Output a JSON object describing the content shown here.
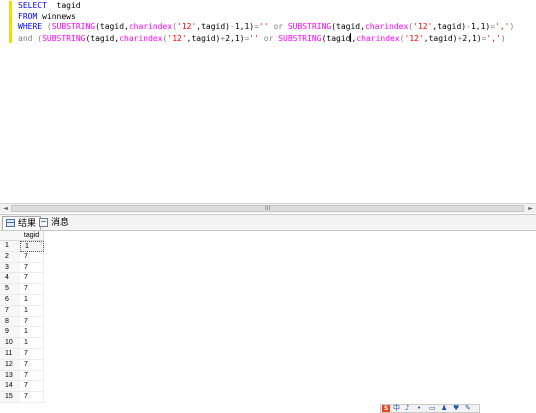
{
  "editor": {
    "lines": [
      [
        {
          "t": "SELECT",
          "c": "kw"
        },
        {
          "t": "  tagid",
          "c": ""
        }
      ],
      [
        {
          "t": "FROM",
          "c": "kw"
        },
        {
          "t": " winnews",
          "c": ""
        }
      ],
      [
        {
          "t": "WHERE",
          "c": "kw"
        },
        {
          "t": " ",
          "c": ""
        },
        {
          "t": "(",
          "c": "op"
        },
        {
          "t": "SUBSTRING",
          "c": "fn"
        },
        {
          "t": "(tagid,",
          "c": ""
        },
        {
          "t": "charindex",
          "c": "fn"
        },
        {
          "t": "(",
          "c": "op"
        },
        {
          "t": "'12'",
          "c": "str"
        },
        {
          "t": ",tagid)",
          "c": ""
        },
        {
          "t": "-",
          "c": "op"
        },
        {
          "t": "1,1)",
          "c": ""
        },
        {
          "t": "=",
          "c": "op"
        },
        {
          "t": "''",
          "c": "str"
        },
        {
          "t": " ",
          "c": ""
        },
        {
          "t": "or",
          "c": "op"
        },
        {
          "t": " ",
          "c": ""
        },
        {
          "t": "SUBSTRING",
          "c": "fn"
        },
        {
          "t": "(tagid,",
          "c": ""
        },
        {
          "t": "charindex",
          "c": "fn"
        },
        {
          "t": "(",
          "c": "op"
        },
        {
          "t": "'12'",
          "c": "str"
        },
        {
          "t": ",tagid)",
          "c": ""
        },
        {
          "t": "-",
          "c": "op"
        },
        {
          "t": "1,1)",
          "c": ""
        },
        {
          "t": "=",
          "c": "op"
        },
        {
          "t": "','",
          "c": "str"
        },
        {
          "t": ")",
          "c": "op"
        }
      ],
      [
        {
          "t": "and",
          "c": "op"
        },
        {
          "t": " ",
          "c": ""
        },
        {
          "t": "(",
          "c": "op"
        },
        {
          "t": "SUBSTRING",
          "c": "fn"
        },
        {
          "t": "(tagid,",
          "c": ""
        },
        {
          "t": "charindex",
          "c": "fn"
        },
        {
          "t": "(",
          "c": "op"
        },
        {
          "t": "'12'",
          "c": "str"
        },
        {
          "t": ",tagid)",
          "c": ""
        },
        {
          "t": "+",
          "c": "op"
        },
        {
          "t": "2,1)",
          "c": ""
        },
        {
          "t": "=",
          "c": "op"
        },
        {
          "t": "''",
          "c": "str"
        },
        {
          "t": " ",
          "c": ""
        },
        {
          "t": "or",
          "c": "op"
        },
        {
          "t": " ",
          "c": ""
        },
        {
          "t": "SUBSTRING",
          "c": "fn"
        },
        {
          "t": "(tagid",
          "c": ""
        },
        {
          "t": "|CARET|",
          "c": "caret"
        },
        {
          "t": ",",
          "c": ""
        },
        {
          "t": "charindex",
          "c": "fn"
        },
        {
          "t": "(",
          "c": "op"
        },
        {
          "t": "'12'",
          "c": "str"
        },
        {
          "t": ",tagid)",
          "c": ""
        },
        {
          "t": "+",
          "c": "op"
        },
        {
          "t": "2,1)",
          "c": ""
        },
        {
          "t": "=",
          "c": "op"
        },
        {
          "t": "','",
          "c": "str"
        },
        {
          "t": ")",
          "c": "op"
        }
      ]
    ]
  },
  "tabs": [
    {
      "label": "结果",
      "icon": "grid-icon",
      "active": true
    },
    {
      "label": "消息",
      "icon": "message-icon",
      "active": false
    }
  ],
  "results": {
    "columns": [
      "tagid"
    ],
    "rows": [
      [
        "1",
        "1"
      ],
      [
        "2",
        "7"
      ],
      [
        "3",
        "7"
      ],
      [
        "4",
        "7"
      ],
      [
        "5",
        "7"
      ],
      [
        "6",
        "1"
      ],
      [
        "7",
        "1"
      ],
      [
        "8",
        "7"
      ],
      [
        "9",
        "1"
      ],
      [
        "10",
        "1"
      ],
      [
        "11",
        "7"
      ],
      [
        "12",
        "7"
      ],
      [
        "13",
        "7"
      ],
      [
        "14",
        "7"
      ],
      [
        "15",
        "7"
      ]
    ],
    "selected_row": 0
  },
  "scrollbar": {
    "left_arrow": "◄",
    "right_arrow": "►",
    "grip": "III"
  },
  "ime_toolbar": {
    "logo": "S",
    "items": [
      "中",
      "♪",
      "•",
      "▭",
      "♟",
      "♥",
      "✎"
    ]
  }
}
